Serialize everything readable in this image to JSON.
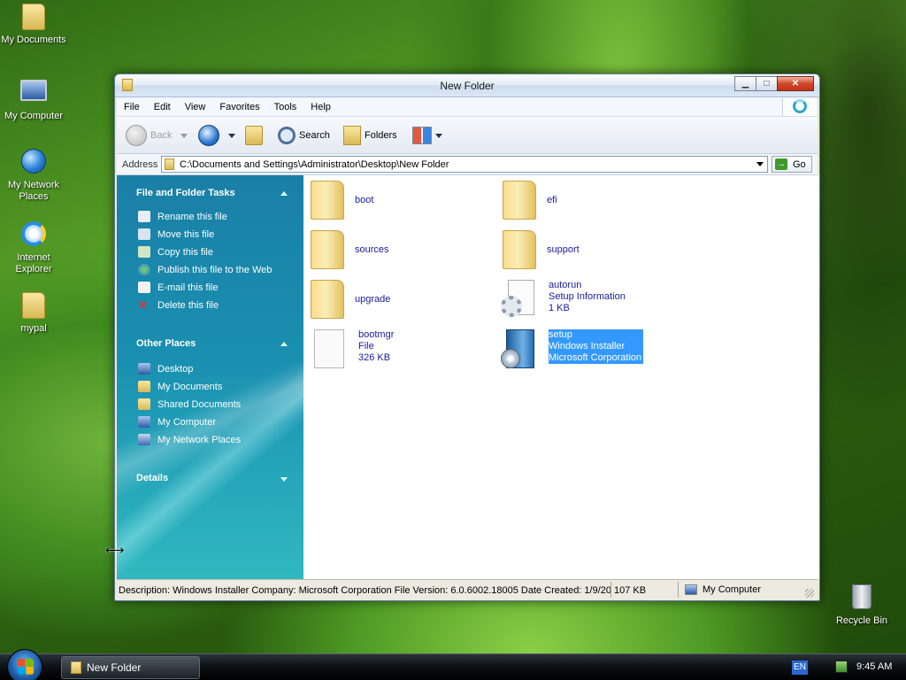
{
  "desktop": {
    "icons": [
      {
        "label": "My Documents",
        "icon": "documents-folder-icon"
      },
      {
        "label": "My Computer",
        "icon": "computer-icon"
      },
      {
        "label": "My Network Places",
        "icon": "network-globe-icon"
      },
      {
        "label": "Internet Explorer",
        "icon": "internet-explorer-icon"
      },
      {
        "label": "mypal",
        "icon": "folder-icon"
      },
      {
        "label": "Recycle Bin",
        "icon": "recycle-bin-icon"
      }
    ]
  },
  "window": {
    "title": "New Folder",
    "controls": {
      "minimize": "▁",
      "maximize": "□",
      "close": "✕"
    }
  },
  "menubar": {
    "items": [
      "File",
      "Edit",
      "View",
      "Favorites",
      "Tools",
      "Help"
    ]
  },
  "toolbar": {
    "back": "Back",
    "search": "Search",
    "folders": "Folders"
  },
  "address": {
    "label": "Address",
    "path": "C:\\Documents and Settings\\Administrator\\Desktop\\New Folder",
    "go": "Go"
  },
  "taskpane": {
    "file_tasks": {
      "title": "File and Folder Tasks",
      "items": [
        {
          "label": "Rename this file",
          "icon": "rename-icon"
        },
        {
          "label": "Move this file",
          "icon": "move-icon"
        },
        {
          "label": "Copy this file",
          "icon": "copy-icon"
        },
        {
          "label": "Publish this file to the Web",
          "icon": "publish-web-icon"
        },
        {
          "label": "E-mail this file",
          "icon": "email-icon"
        },
        {
          "label": "Delete this file",
          "icon": "delete-icon"
        }
      ]
    },
    "other_places": {
      "title": "Other Places",
      "items": [
        {
          "label": "Desktop",
          "icon": "desktop-icon"
        },
        {
          "label": "My Documents",
          "icon": "documents-icon"
        },
        {
          "label": "Shared Documents",
          "icon": "shared-documents-icon"
        },
        {
          "label": "My Computer",
          "icon": "computer-icon"
        },
        {
          "label": "My Network Places",
          "icon": "network-icon"
        }
      ]
    },
    "details": {
      "title": "Details"
    }
  },
  "files": [
    {
      "name": "boot",
      "type": "folder"
    },
    {
      "name": "efi",
      "type": "folder"
    },
    {
      "name": "sources",
      "type": "folder"
    },
    {
      "name": "support",
      "type": "folder"
    },
    {
      "name": "upgrade",
      "type": "folder"
    },
    {
      "name": "autorun",
      "line2": "Setup Information",
      "line3": "1 KB",
      "type": "inf"
    },
    {
      "name": "bootmgr",
      "line2": "File",
      "line3": "326 KB",
      "type": "file"
    },
    {
      "name": "setup",
      "line2": "Windows Installer",
      "line3": "Microsoft Corporation",
      "type": "msi",
      "selected": true
    }
  ],
  "statusbar": {
    "description": "Description: Windows Installer Company: Microsoft Corporation File Version: 6.0.6002.18005 Date Created: 1/9/20:",
    "size": "107 KB",
    "location": "My Computer"
  },
  "taskbar": {
    "task_label": "New Folder",
    "language": "EN",
    "clock": "9:45 AM"
  },
  "colors": {
    "selection": "#3399ff",
    "taskpane_top": "#1a7fa6",
    "file_text": "#1a1aa0"
  }
}
